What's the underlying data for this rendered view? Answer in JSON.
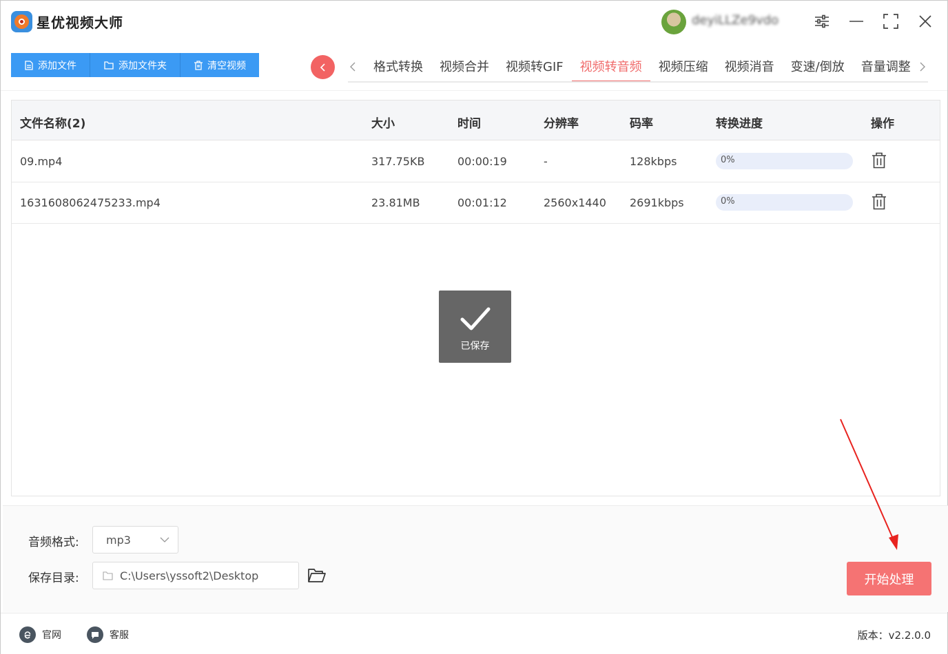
{
  "app": {
    "title": "星优视频大师",
    "brand_color": "#3b9af4",
    "accent_color": "#f06b6b"
  },
  "user": {
    "name": "deyiLLZe9vdo"
  },
  "toolbar": {
    "add_file": "添加文件",
    "add_folder": "添加文件夹",
    "clear_videos": "清空视频"
  },
  "tabs": [
    {
      "label": "格式转换",
      "active": false
    },
    {
      "label": "视频合并",
      "active": false
    },
    {
      "label": "视频转GIF",
      "active": false
    },
    {
      "label": "视频转音频",
      "active": true
    },
    {
      "label": "视频压缩",
      "active": false
    },
    {
      "label": "视频消音",
      "active": false
    },
    {
      "label": "变速/倒放",
      "active": false
    },
    {
      "label": "音量调整",
      "active": false
    }
  ],
  "table": {
    "headers": {
      "name": "文件名称(2)",
      "size": "大小",
      "time": "时间",
      "resolution": "分辨率",
      "bitrate": "码率",
      "progress": "转换进度",
      "action": "操作"
    },
    "rows": [
      {
        "name": "09.mp4",
        "size": "317.75KB",
        "time": "00:00:19",
        "resolution": "-",
        "bitrate": "128kbps",
        "progress": 0,
        "progress_label": "0%"
      },
      {
        "name": "1631608062475233.mp4",
        "size": "23.81MB",
        "time": "00:01:12",
        "resolution": "2560x1440",
        "bitrate": "2691kbps",
        "progress": 0,
        "progress_label": "0%"
      }
    ]
  },
  "toast": {
    "text": "已保存"
  },
  "settings": {
    "format_label": "音频格式:",
    "format_value": "mp3",
    "dir_label": "保存目录:",
    "dir_value": "C:\\Users\\yssoft2\\Desktop"
  },
  "start_button": "开始处理",
  "footer": {
    "website": "官网",
    "support": "客服",
    "version": "版本：v2.2.0.0"
  },
  "icons": [
    "file-icon",
    "folder-icon",
    "trash-icon",
    "settings-icon",
    "minimize-icon",
    "maximize-icon",
    "close-icon",
    "chevron-left-icon",
    "chevron-right-icon",
    "check-icon",
    "chevron-down-icon",
    "open-folder-icon",
    "ie-icon",
    "chat-icon"
  ]
}
